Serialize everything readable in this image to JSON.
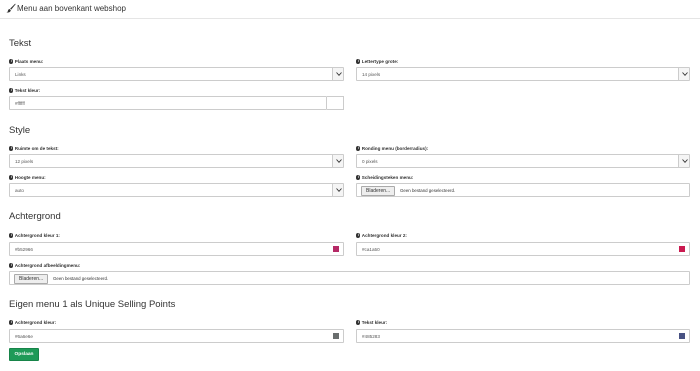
{
  "header": {
    "title": "Menu aan bovenkant webshop",
    "icon": "paintbrush-icon"
  },
  "sections": {
    "tekst": "Tekst",
    "style": "Style",
    "achtergrond": "Achtergrond",
    "usp": "Eigen menu 1 als Unique Selling Points"
  },
  "fields": {
    "plaats_menu": {
      "label": "Plaats menu:",
      "value": "Links"
    },
    "lettertype_grootte": {
      "label": "Lettertype grote:",
      "value": "14 pixels"
    },
    "tekst_kleur": {
      "label": "Tekst kleur:",
      "value": "#ffffff"
    },
    "ruimte_om_tekst": {
      "label": "Ruimte om de tekst:",
      "value": "12 pixels"
    },
    "ronding_menu": {
      "label": "Ronding menu (borderradius):",
      "value": "0 pixels"
    },
    "hoogte_menu": {
      "label": "Hoogte menu:",
      "value": "auto"
    },
    "scheidingsteken_menu": {
      "label": "Scheidingsteken menu:",
      "button": "Bladeren...",
      "status": "Geen bestand geselecteerd."
    },
    "achtergrond_kleur_1": {
      "label": "Achtergrond kleur 1:",
      "value": "#b52966",
      "swatch": "#b52966"
    },
    "achtergrond_kleur_2": {
      "label": "Achtergrond kleur 2:",
      "value": "#ca1a50",
      "swatch": "#ca1a50"
    },
    "achtergrond_afbeelding": {
      "label": "Achtergrond afbeeldingmenu:",
      "button": "Bladeren...",
      "status": "Geen bestand geselecteerd."
    },
    "usp_achtergrond_kleur": {
      "label": "Achtergrond kleur:",
      "value": "#6a6e6e",
      "swatch": "#6a6e6e"
    },
    "usp_tekst_kleur": {
      "label": "Tekst kleur:",
      "value": "#485283",
      "swatch": "#485283"
    }
  },
  "actions": {
    "save_label": "Opslaan",
    "save_color": "#1e9a58"
  }
}
